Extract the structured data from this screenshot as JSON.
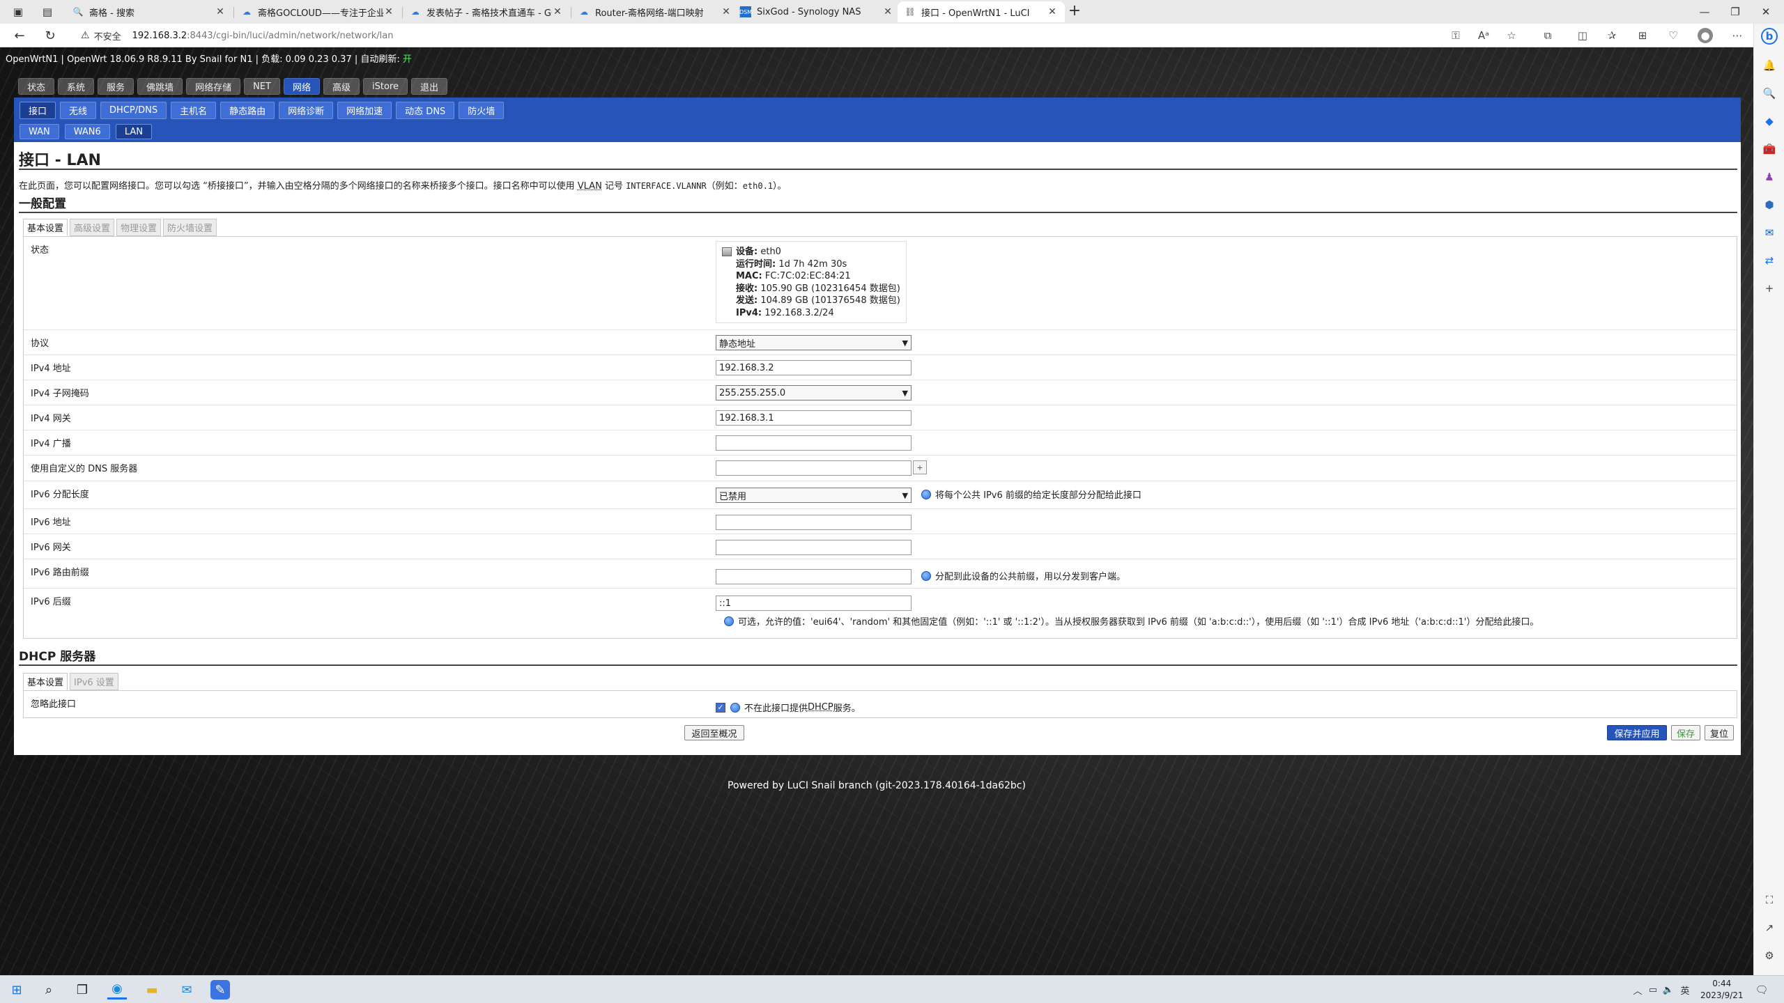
{
  "browser": {
    "tabs": [
      {
        "title": "斋格 - 搜索",
        "icon": "search-icon",
        "active": false
      },
      {
        "title": "斋格GOCLOUD——专注于企业...",
        "icon": "cloud-icon",
        "active": false
      },
      {
        "title": "发表帖子 - 斋格技术直通车 - GO...",
        "icon": "cloud-icon",
        "active": false
      },
      {
        "title": "Router-斋格网络-端口映射",
        "icon": "cloud-icon",
        "active": false
      },
      {
        "title": "SixGod - Synology NAS",
        "icon": "dsm-icon",
        "active": false
      },
      {
        "title": "接口 - OpenWrtN1 - LuCI",
        "icon": "page-icon",
        "active": true
      }
    ],
    "url_warning": "不安全",
    "url_host": "192.168.3.2",
    "url_path": ":8443/cgi-bin/luci/admin/network/network/lan"
  },
  "router": {
    "host_line": "OpenWrtN1 | OpenWrt 18.06.9 R8.9.11 By Snail for N1 | 负载: 0.09 0.23 0.37 | 自动刷新: ",
    "auto_refresh": "开",
    "top_nav": [
      "状态",
      "系统",
      "服务",
      "佛跳墙",
      "网络存储",
      "NET",
      "网络",
      "高级",
      "iStore",
      "退出"
    ],
    "top_nav_active": "网络",
    "sub_nav": [
      "接口",
      "无线",
      "DHCP/DNS",
      "主机名",
      "静态路由",
      "网络诊断",
      "网络加速",
      "动态 DNS",
      "防火墙"
    ],
    "sub_nav_active": "接口",
    "interfaces": [
      "WAN",
      "WAN6",
      "LAN"
    ],
    "interface_active": "LAN"
  },
  "page": {
    "title": "接口 - LAN",
    "desc_before": "在此页面，您可以配置网络接口。您可以勾选 “桥接接口”，并输入由空格分隔的多个网络接口的名称来桥接多个接口。接口名称中可以使用 ",
    "desc_vlan": "VLAN",
    "desc_mid": " 记号 ",
    "desc_code1": "INTERFACE.VLANNR",
    "desc_mid2": "（例如：",
    "desc_code2": "eth0.1",
    "desc_end": "）。"
  },
  "general": {
    "section_title": "一般配置",
    "tabs": [
      "基本设置",
      "高级设置",
      "物理设置",
      "防火墙设置"
    ],
    "status_label": "状态",
    "status": {
      "device_label": "设备:",
      "device": "eth0",
      "uptime_label": "运行时间:",
      "uptime": "1d 7h 42m 30s",
      "mac_label": "MAC:",
      "mac": "FC:7C:02:EC:84:21",
      "rx_label": "接收:",
      "rx": "105.90 GB (102316454 数据包)",
      "tx_label": "发送:",
      "tx": "104.89 GB (101376548 数据包)",
      "ipv4_label": "IPv4:",
      "ipv4": "192.168.3.2/24"
    },
    "fields": {
      "protocol_label": "协议",
      "protocol_value": "静态地址",
      "ipv4_addr_label": "IPv4 地址",
      "ipv4_addr_value": "192.168.3.2",
      "netmask_label": "IPv4 子网掩码",
      "netmask_value": "255.255.255.0",
      "gateway_label": "IPv4 网关",
      "gateway_value": "192.168.3.1",
      "broadcast_label": "IPv4 广播",
      "broadcast_value": "",
      "dns_label": "使用自定义的 DNS 服务器",
      "dns_value": "",
      "dns_add": "+",
      "ip6assign_label": "IPv6 分配长度",
      "ip6assign_value": "已禁用",
      "ip6assign_hint": "将每个公共 IPv6 前缀的给定长度部分分配给此接口",
      "ip6addr_label": "IPv6 地址",
      "ip6addr_value": "",
      "ip6gw_label": "IPv6 网关",
      "ip6gw_value": "",
      "ip6prefix_label": "IPv6 路由前缀",
      "ip6prefix_value": "",
      "ip6prefix_hint": "分配到此设备的公共前缀，用以分发到客户端。",
      "ip6suffix_label": "IPv6 后缀",
      "ip6suffix_value": "::1",
      "ip6suffix_hint": "可选，允许的值：'eui64'、'random' 和其他固定值（例如：'::1' 或 '::1:2'）。当从授权服务器获取到 IPv6 前缀（如 'a:b:c:d::'），使用后缀（如 '::1'）合成 IPv6 地址（'a:b:c:d::1'）分配给此接口。"
    }
  },
  "dhcp": {
    "section_title": "DHCP 服务器",
    "tabs": [
      "基本设置",
      "IPv6 设置"
    ],
    "ignore_label": "忽略此接口",
    "ignore_hint_before": "不在此接口提供 ",
    "ignore_hint_dhcp": "DHCP",
    "ignore_hint_after": " 服务。",
    "ignore_checked": true
  },
  "actions": {
    "back": "返回至概况",
    "save_apply": "保存并应用",
    "save": "保存",
    "reset": "复位"
  },
  "footer": "Powered by LuCI Snail branch (git-2023.178.40164-1da62bc)",
  "taskbar": {
    "time": "0:44",
    "date": "2023/9/21",
    "ime": "英"
  }
}
